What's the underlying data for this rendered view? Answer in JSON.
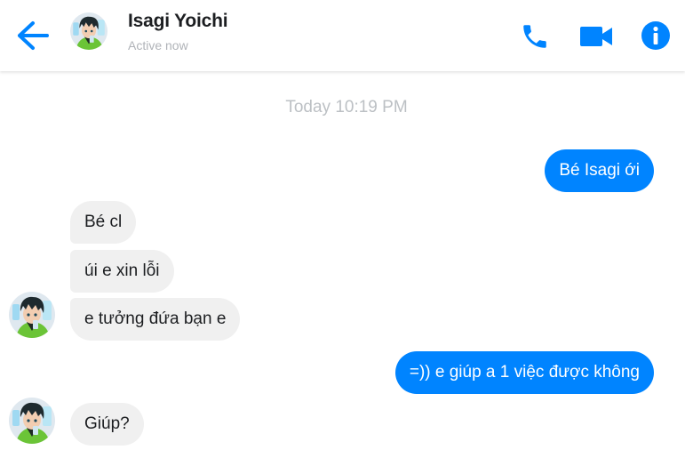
{
  "header": {
    "contact_name": "Isagi Yoichi",
    "status": "Active now"
  },
  "icons": {
    "back": "arrow-left-icon",
    "call": "phone-icon",
    "video": "video-camera-icon",
    "info": "info-icon"
  },
  "colors": {
    "accent": "#0084ff",
    "incoming_bubble": "#f0f0f0",
    "timestamp": "#bcc0c4"
  },
  "conversation": {
    "timestamp": "Today 10:19 PM",
    "messages": [
      {
        "direction": "outgoing",
        "text": "Bé Isagi ới"
      },
      {
        "direction": "incoming",
        "text": "Bé cl"
      },
      {
        "direction": "incoming",
        "text": "úi e xin lỗi"
      },
      {
        "direction": "incoming",
        "text": "e tưởng đứa bạn e"
      },
      {
        "direction": "outgoing",
        "text": "=)) e giúp a 1 việc được không"
      },
      {
        "direction": "incoming",
        "text": "Giúp?"
      }
    ]
  }
}
